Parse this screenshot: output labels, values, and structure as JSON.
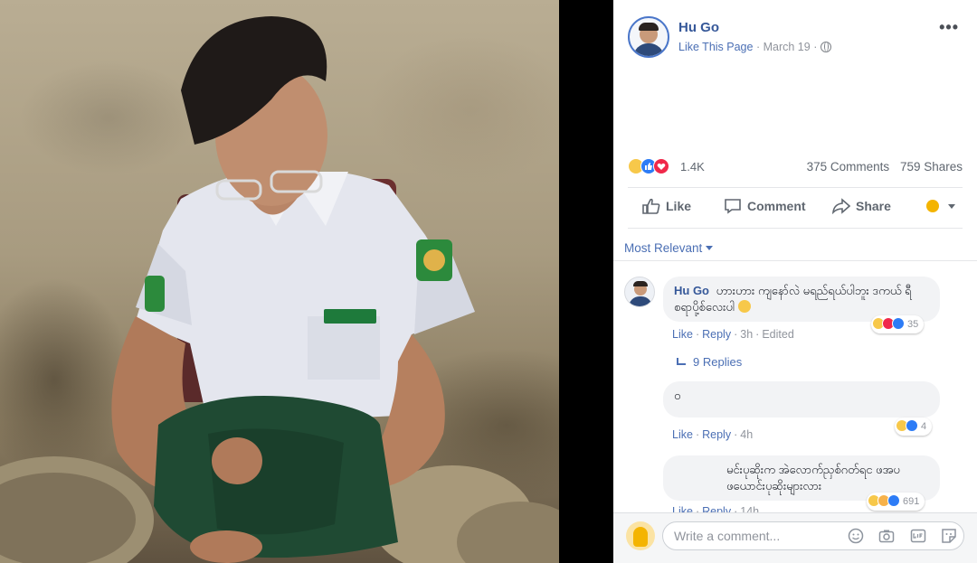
{
  "post": {
    "page_name": "Hu Go",
    "like_page": "Like This Page",
    "date": "March 19",
    "reaction_count": "1.4K",
    "comments": "375 Comments",
    "shares": "759 Shares"
  },
  "actions": {
    "like": "Like",
    "comment": "Comment",
    "share": "Share"
  },
  "sort": {
    "label": "Most Relevant"
  },
  "comments": [
    {
      "author": "Hu Go",
      "text": "ဟားဟား ကျနော်လဲ မရည်ရယ်ပါဘူး ဒကယ် ရီစရာပို့စ်လေးပါ",
      "reaction_count": "35",
      "like": "Like",
      "reply": "Reply",
      "time": "3h",
      "edited": "Edited",
      "replies": "9 Replies"
    },
    {
      "author": "",
      "text": "ဝ",
      "reaction_count": "4",
      "like": "Like",
      "reply": "Reply",
      "time": "4h"
    },
    {
      "author": "",
      "text": "မင်းပုဆိုးက အဲလောက်ညှစ်ဂတ်ရင ဖအပ ဖယောင်းပုဆိုးများလား",
      "reaction_count": "691",
      "like": "Like",
      "reply": "Reply",
      "time": "14h"
    }
  ],
  "composer": {
    "placeholder": "Write a comment..."
  },
  "colors": {
    "link_blue": "#365899",
    "like_blue": "#2d7cf6",
    "love_red": "#f0284a",
    "haha_yellow": "#f7c84a"
  }
}
